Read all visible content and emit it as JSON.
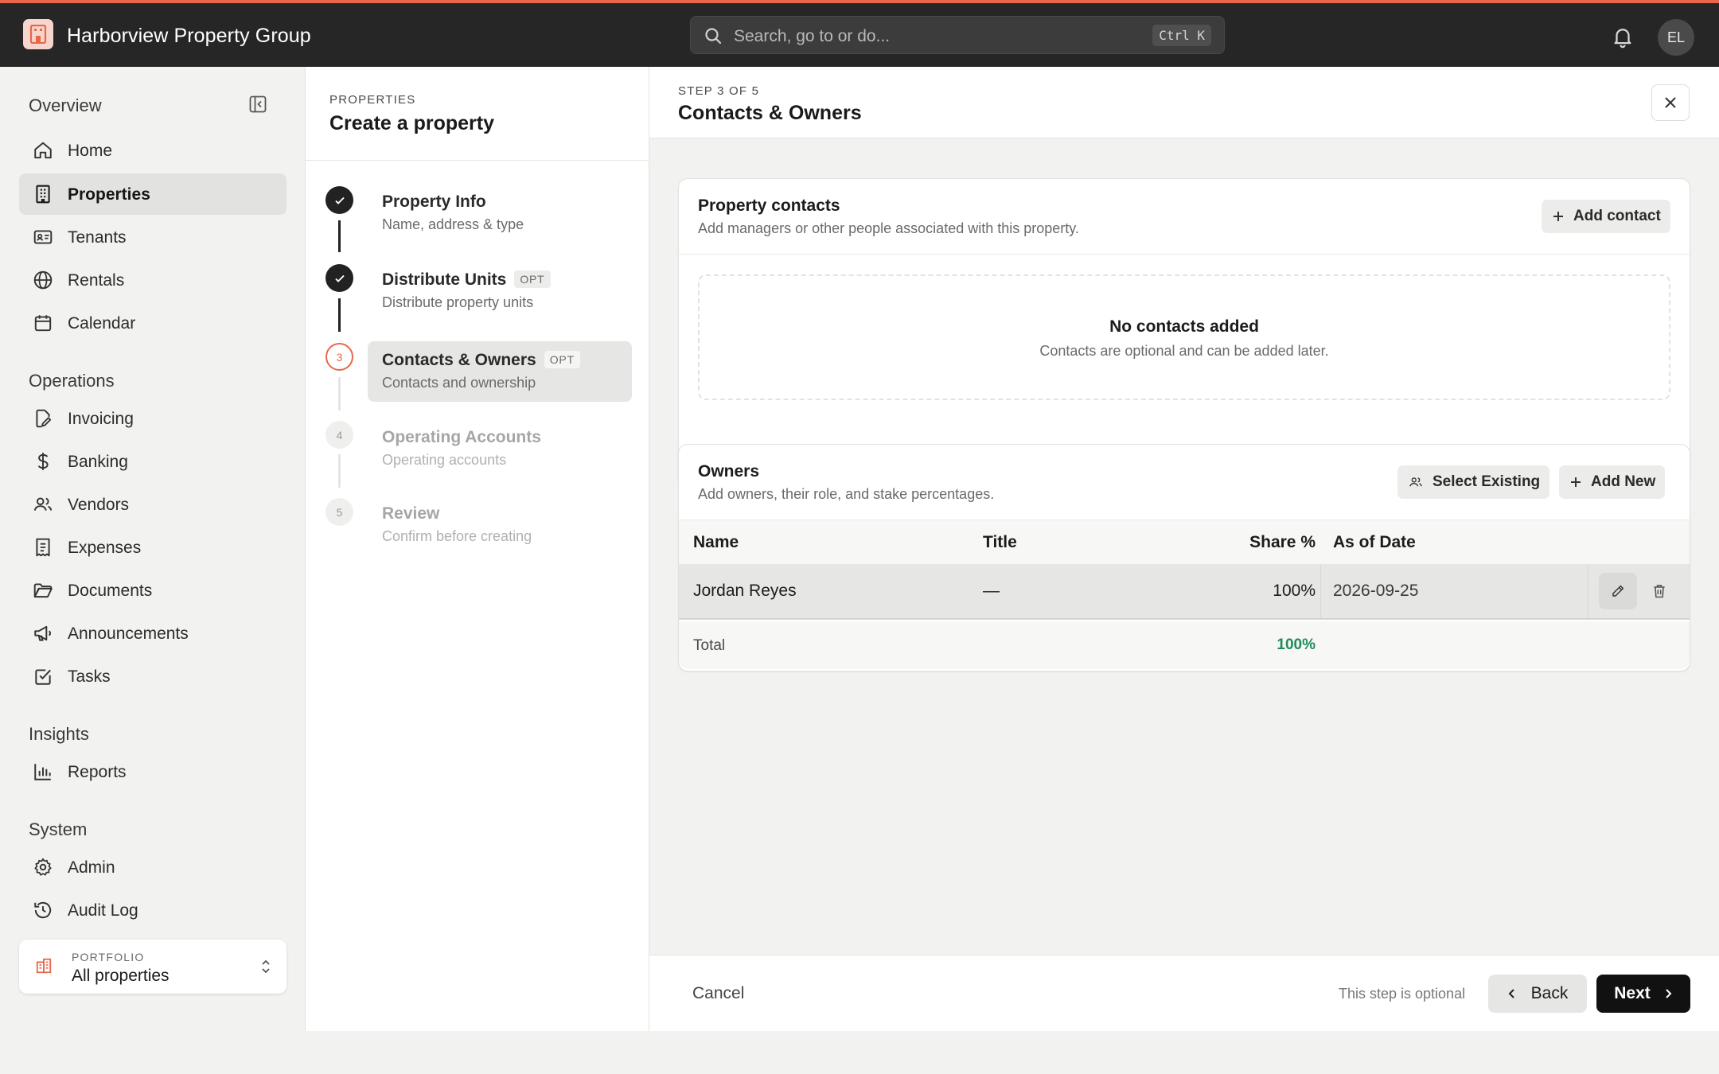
{
  "app": {
    "brand_name": "Harborview Property Group",
    "accent_color": "#e8674a",
    "search_placeholder": "Search, go to or do...",
    "search_shortcut": "Ctrl K",
    "user_initials": "EL"
  },
  "sidebar": {
    "sections": [
      {
        "title": "Overview",
        "items": [
          {
            "label": "Home",
            "icon": "home-icon"
          },
          {
            "label": "Properties",
            "icon": "building-icon",
            "active": true
          },
          {
            "label": "Tenants",
            "icon": "id-card-icon"
          },
          {
            "label": "Rentals",
            "icon": "globe-icon"
          },
          {
            "label": "Calendar",
            "icon": "calendar-icon"
          }
        ]
      },
      {
        "title": "Operations",
        "items": [
          {
            "label": "Invoicing",
            "icon": "invoice-edit-icon"
          },
          {
            "label": "Banking",
            "icon": "dollar-icon"
          },
          {
            "label": "Vendors",
            "icon": "users-icon"
          },
          {
            "label": "Expenses",
            "icon": "receipt-icon"
          },
          {
            "label": "Documents",
            "icon": "folder-icon"
          },
          {
            "label": "Announcements",
            "icon": "megaphone-icon"
          },
          {
            "label": "Tasks",
            "icon": "checkbox-icon"
          }
        ]
      },
      {
        "title": "Insights",
        "items": [
          {
            "label": "Reports",
            "icon": "bar-chart-icon"
          }
        ]
      },
      {
        "title": "System",
        "items": [
          {
            "label": "Admin",
            "icon": "gear-icon"
          },
          {
            "label": "Audit Log",
            "icon": "history-icon"
          }
        ]
      }
    ],
    "portfolio": {
      "kicker": "PORTFOLIO",
      "value": "All properties"
    }
  },
  "stepper": {
    "kicker": "PROPERTIES",
    "title": "Create a property",
    "steps": [
      {
        "number": "1",
        "name": "Property Info",
        "desc": "Name, address & type",
        "status": "done",
        "badge": ""
      },
      {
        "number": "2",
        "name": "Distribute Units",
        "desc": "Distribute property units",
        "status": "done",
        "badge": "OPT"
      },
      {
        "number": "3",
        "name": "Contacts & Owners",
        "desc": "Contacts and ownership",
        "status": "current",
        "badge": "OPT"
      },
      {
        "number": "4",
        "name": "Operating Accounts",
        "desc": "Operating accounts",
        "status": "pending",
        "badge": ""
      },
      {
        "number": "5",
        "name": "Review",
        "desc": "Confirm before creating",
        "status": "pending",
        "badge": ""
      }
    ]
  },
  "main": {
    "kicker": "STEP 3 OF 5",
    "title": "Contacts & Owners",
    "contacts": {
      "title": "Property contacts",
      "subtitle": "Add managers or other people associated with this property.",
      "add_label": "Add contact",
      "empty_title": "No contacts added",
      "empty_sub": "Contacts are optional and can be added later."
    },
    "owners": {
      "title": "Owners",
      "subtitle": "Add owners, their role, and stake percentages.",
      "select_existing_label": "Select Existing",
      "add_new_label": "Add New",
      "columns": {
        "name": "Name",
        "title": "Title",
        "share": "Share %",
        "date": "As of Date"
      },
      "rows": [
        {
          "name": "Jordan Reyes",
          "title": "—",
          "share": "100%",
          "date": "2026-09-25"
        }
      ],
      "total_label": "Total",
      "total_value": "100%",
      "total_color": "#1e8a5a"
    },
    "footer": {
      "cancel_label": "Cancel",
      "optional_note": "This step is optional",
      "back_label": "Back",
      "next_label": "Next"
    }
  }
}
